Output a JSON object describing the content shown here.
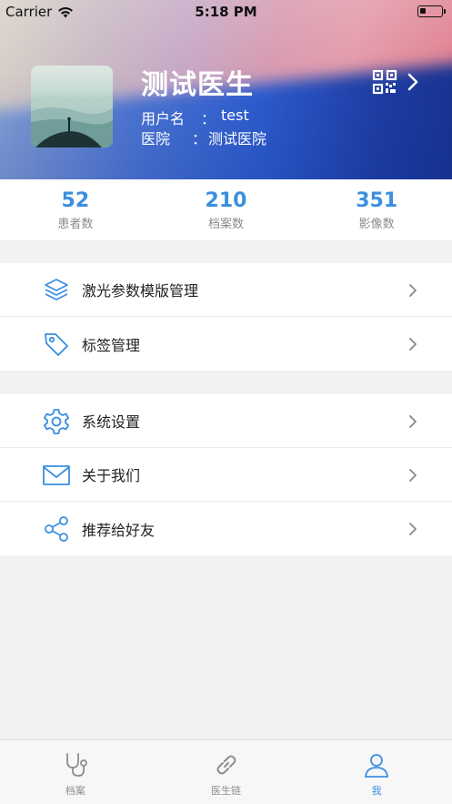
{
  "status_bar": {
    "carrier": "Carrier",
    "time": "5:18 PM"
  },
  "profile": {
    "name": "测试医生",
    "username_label": "用户名",
    "username_value": "test",
    "hospital_label": "医院",
    "hospital_value": "测试医院",
    "separator": "："
  },
  "stats": [
    {
      "value": "52",
      "label": "患者数"
    },
    {
      "value": "210",
      "label": "档案数"
    },
    {
      "value": "351",
      "label": "影像数"
    }
  ],
  "menu_groups": [
    [
      {
        "label": "激光参数模版管理",
        "icon": "layers-icon"
      },
      {
        "label": "标签管理",
        "icon": "tag-icon"
      }
    ],
    [
      {
        "label": "系统设置",
        "icon": "gear-icon"
      },
      {
        "label": "关于我们",
        "icon": "mail-icon"
      },
      {
        "label": "推荐给好友",
        "icon": "share-icon"
      }
    ]
  ],
  "tabbar": [
    {
      "label": "档案",
      "icon": "stethoscope-icon",
      "active": false
    },
    {
      "label": "医生链",
      "icon": "link-icon",
      "active": false
    },
    {
      "label": "我",
      "icon": "person-icon",
      "active": true
    }
  ],
  "colors": {
    "accent": "#3b8fe0",
    "header_gradient_start": "#d8d2c8",
    "header_gradient_end": "#16308a"
  }
}
